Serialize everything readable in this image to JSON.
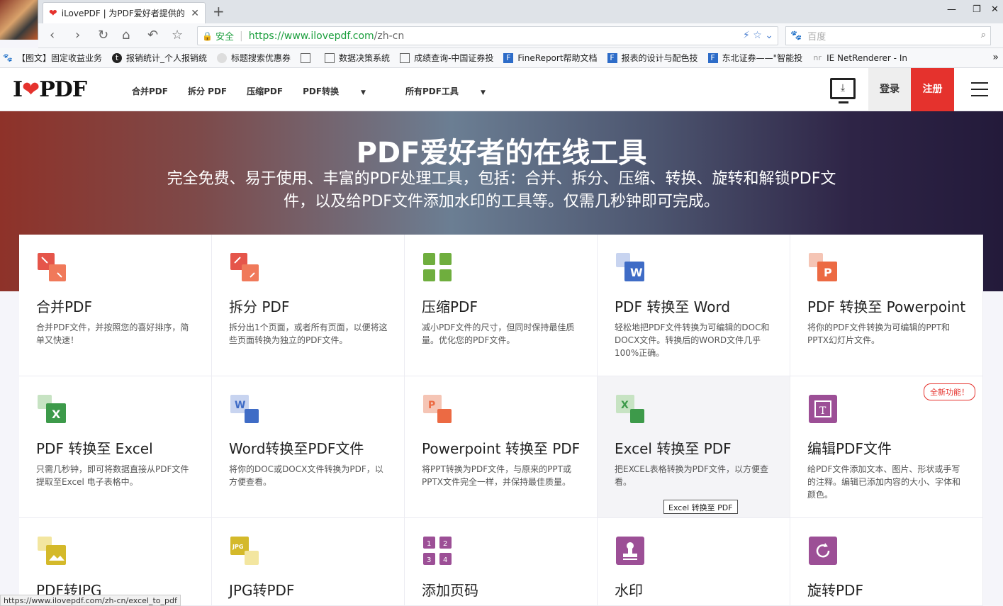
{
  "browser": {
    "tab_title": "iLovePDF | 为PDF爱好者提供的",
    "url_secure_label": "安全",
    "url_host": "https://www.ilovepdf.com",
    "url_path": "/zh-cn",
    "search_placeholder": "百度",
    "bookmarks": [
      "【图文】固定收益业务",
      "报销统计_个人报销统",
      "标题搜索优惠券",
      "",
      "数据决策系统",
      "成绩查询-中国证券投",
      "FineReport帮助文档",
      "报表的设计与配色技",
      "东北证券——\"智能投",
      "IE NetRenderer - In"
    ],
    "status_url": "https://www.ilovepdf.com/zh-cn/excel_to_pdf"
  },
  "site": {
    "logo_pre": "I",
    "logo_heart": "❤",
    "logo_post": "PDF",
    "menu": [
      "合并PDF",
      "拆分 PDF",
      "压缩PDF",
      "PDF转换",
      "所有PDF工具"
    ],
    "login": "登录",
    "signup": "注册"
  },
  "hero": {
    "title": "PDF爱好者的在线工具",
    "subtitle": "完全免费、易于使用、丰富的PDF处理工具，包括：合并、拆分、压缩、转换、旋转和解锁PDF文件，以及给PDF文件添加水印的工具等。仅需几秒钟即可完成。"
  },
  "tools": [
    {
      "title": "合并PDF",
      "desc": "合并PDF文件，并按照您的喜好排序，简单又快速！"
    },
    {
      "title": "拆分 PDF",
      "desc": "拆分出1个页面，或者所有页面，以便将这些页面转换为独立的PDF文件。"
    },
    {
      "title": "压缩PDF",
      "desc": "减小PDF文件的尺寸，但同时保持最佳质量。优化您的PDF文件。"
    },
    {
      "title": "PDF 转换至 Word",
      "desc": "轻松地把PDF文件转换为可编辑的DOC和DOCX文件。转换后的WORD文件几乎100%正确。"
    },
    {
      "title": "PDF 转换至 Powerpoint",
      "desc": "将你的PDF文件转换为可编辑的PPT和PPTX幻灯片文件。"
    },
    {
      "title": "PDF 转换至 Excel",
      "desc": "只需几秒钟，即可将数据直接从PDF文件提取至Excel 电子表格中。"
    },
    {
      "title": "Word转换至PDF文件",
      "desc": "将你的DOC或DOCX文件转换为PDF，以方便查看。"
    },
    {
      "title": "Powerpoint 转换至 PDF",
      "desc": "将PPT转换为PDF文件，与原来的PPT或PPTX文件完全一样，并保持最佳质量。"
    },
    {
      "title": "Excel 转换至 PDF",
      "desc": "把EXCEL表格转换为PDF文件，以方便查看。"
    },
    {
      "title": "编辑PDF文件",
      "desc": "给PDF文件添加文本、图片、形状或手写的注释。编辑已添加内容的大小、字体和颜色。",
      "badge": "全新功能！"
    },
    {
      "title": "PDF转JPG",
      "desc": ""
    },
    {
      "title": "JPG转PDF",
      "desc": ""
    },
    {
      "title": "添加页码",
      "desc": ""
    },
    {
      "title": "水印",
      "desc": ""
    },
    {
      "title": "旋转PDF",
      "desc": ""
    }
  ],
  "tooltip": "Excel 转换至 PDF",
  "colors": {
    "brand_red": "#e5322d",
    "green": "#1a9e3c"
  }
}
